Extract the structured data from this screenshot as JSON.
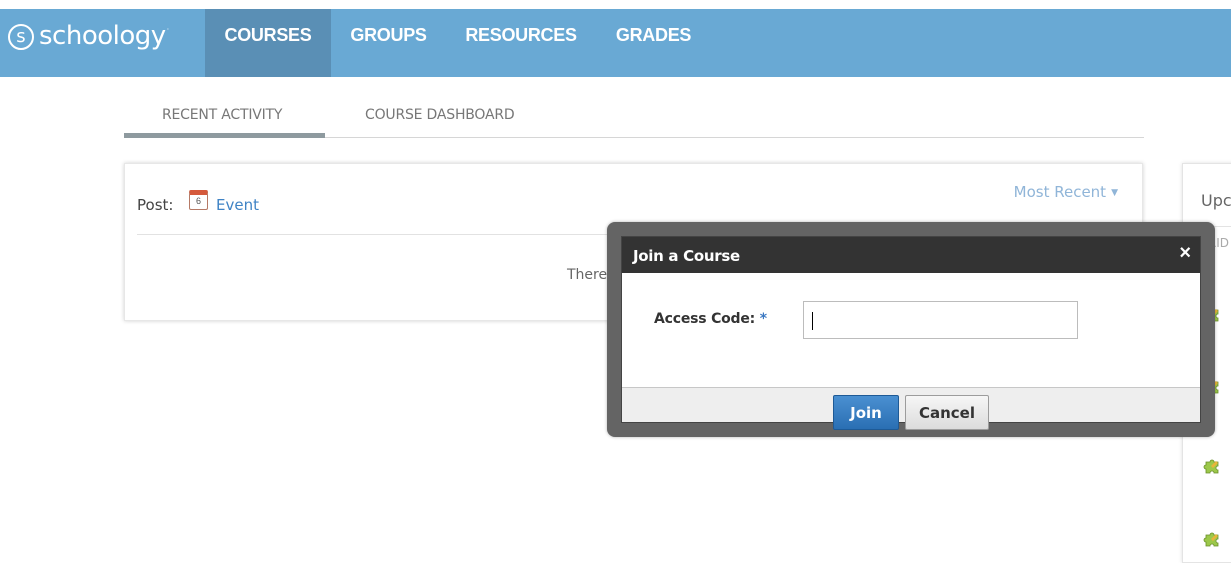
{
  "nav": {
    "logo_text": "schoology",
    "logo_mark": "s",
    "items": [
      {
        "label": "COURSES",
        "active": true
      },
      {
        "label": "GROUPS",
        "active": false
      },
      {
        "label": "RESOURCES",
        "active": false
      },
      {
        "label": "GRADES",
        "active": false
      }
    ],
    "bar_color": "#69a9d4",
    "active_color": "#5a8fb5"
  },
  "tabs": {
    "items": [
      {
        "label": "RECENT ACTIVITY",
        "active": true
      },
      {
        "label": "COURSE DASHBOARD",
        "active": false
      }
    ]
  },
  "feed": {
    "post_label": "Post:",
    "calendar_day": "6",
    "event_label": "Event",
    "sort_label": "Most Recent",
    "empty_message_partial": "There a"
  },
  "sidebar": {
    "heading_partial": "Upc",
    "day_partial": "FRID"
  },
  "dialog": {
    "title": "Join a Course",
    "close_glyph": "×",
    "access_code_label": "Access Code:",
    "required_marker": "*",
    "access_code_value": "",
    "join_label": "Join",
    "cancel_label": "Cancel"
  }
}
